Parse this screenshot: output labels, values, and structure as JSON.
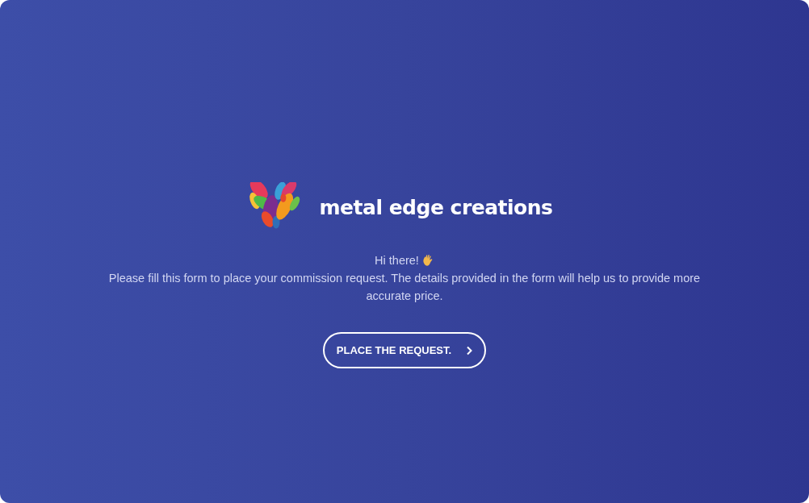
{
  "brand": {
    "name": "metal edge creations"
  },
  "intro": {
    "greeting": "Hi there!",
    "message": "Please fill this form to place your commission request. The details provided in the form will help us to provide more accurate price."
  },
  "button": {
    "label": "PLACE THE REQUEST."
  }
}
